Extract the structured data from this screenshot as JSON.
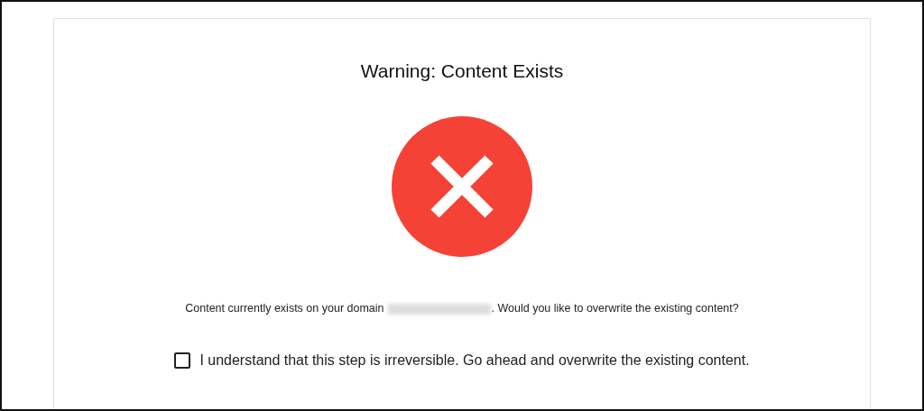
{
  "dialog": {
    "title": "Warning: Content Exists",
    "message_before": "Content currently exists on your domain",
    "message_after": ". Would you like to overwrite the existing content?",
    "confirm": {
      "label": "I understand that this step is irreversible. Go ahead and overwrite the existing content.",
      "checked": false
    }
  }
}
